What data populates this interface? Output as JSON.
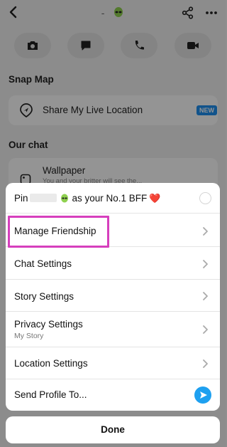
{
  "header": {
    "name_placeholder": "-"
  },
  "snap_map": {
    "section_title": "Snap Map",
    "share_location_label": "Share My Live Location",
    "new_badge": "NEW"
  },
  "our_chat": {
    "section_title": "Our chat",
    "wallpaper_label": "Wallpaper",
    "wallpaper_sub": "You and your britter will see the..."
  },
  "sheet": {
    "pin_prefix": "Pin",
    "pin_suffix": "as your No.1 BFF",
    "pin_heart": "❤️",
    "items": [
      {
        "label": "Manage Friendship"
      },
      {
        "label": "Chat Settings"
      },
      {
        "label": "Story Settings"
      },
      {
        "label": "Privacy Settings",
        "sub": "My Story"
      },
      {
        "label": "Location Settings"
      },
      {
        "label": "Send Profile To..."
      }
    ]
  },
  "done_label": "Done",
  "colors": {
    "highlight": "#d63fbd",
    "accent_blue": "#1ea0f0",
    "heart": "#e0343c"
  },
  "icons": [
    "back-icon",
    "alien-emoji-icon",
    "share-icon",
    "more-icon",
    "camera-icon",
    "chat-icon",
    "phone-icon",
    "video-icon",
    "location-pin-icon",
    "wallpaper-icon",
    "chevron-right-icon",
    "send-arrow-icon"
  ]
}
